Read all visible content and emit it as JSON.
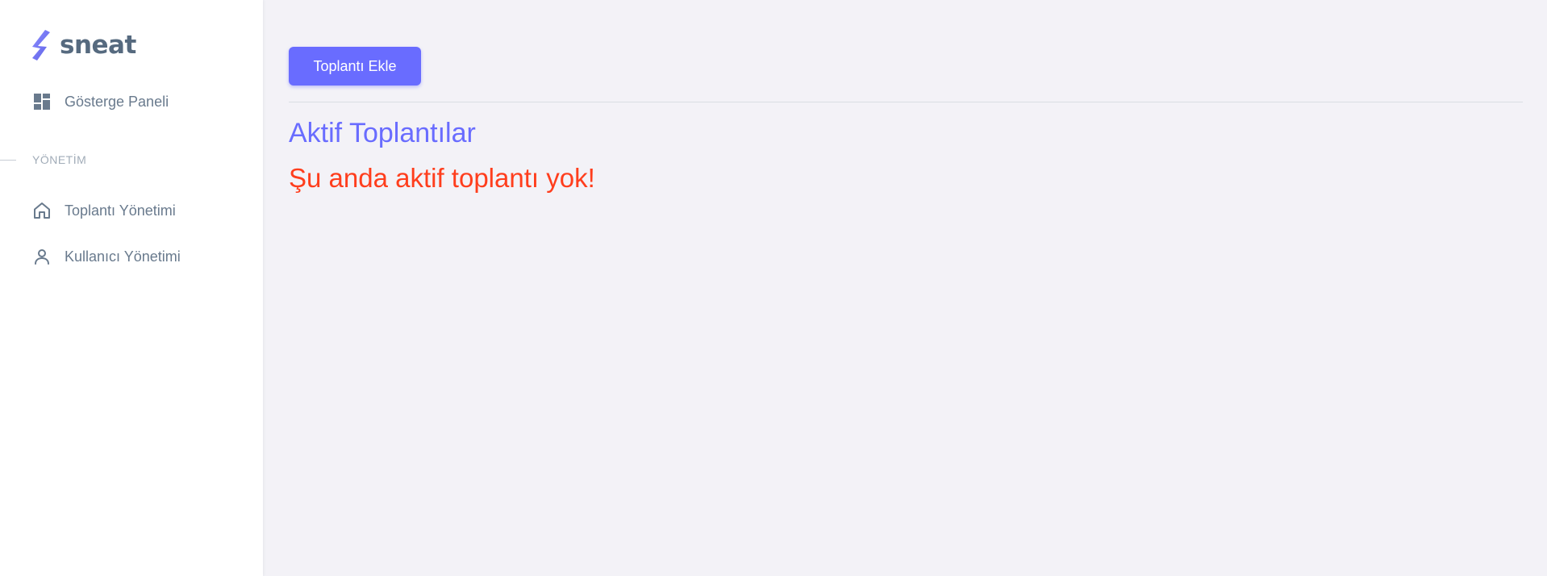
{
  "brand": {
    "name": "sneat",
    "logo_icon": "sneat-logo-icon"
  },
  "sidebar": {
    "dashboard": {
      "label": "Gösterge Paneli",
      "icon": "dashboard-icon"
    },
    "section_header": "YÖNETİM",
    "items": [
      {
        "label": "Toplantı Yönetimi",
        "icon": "home-icon"
      },
      {
        "label": "Kullanıcı Yönetimi",
        "icon": "user-icon"
      }
    ]
  },
  "main": {
    "add_button_label": "Toplantı Ekle",
    "section_title": "Aktif Toplantılar",
    "empty_message": "Şu anda aktif toplantı yok!"
  },
  "colors": {
    "primary": "#696cff",
    "danger": "#ff3e1d",
    "text_muted": "#697a8d",
    "background": "#f3f2f7"
  }
}
